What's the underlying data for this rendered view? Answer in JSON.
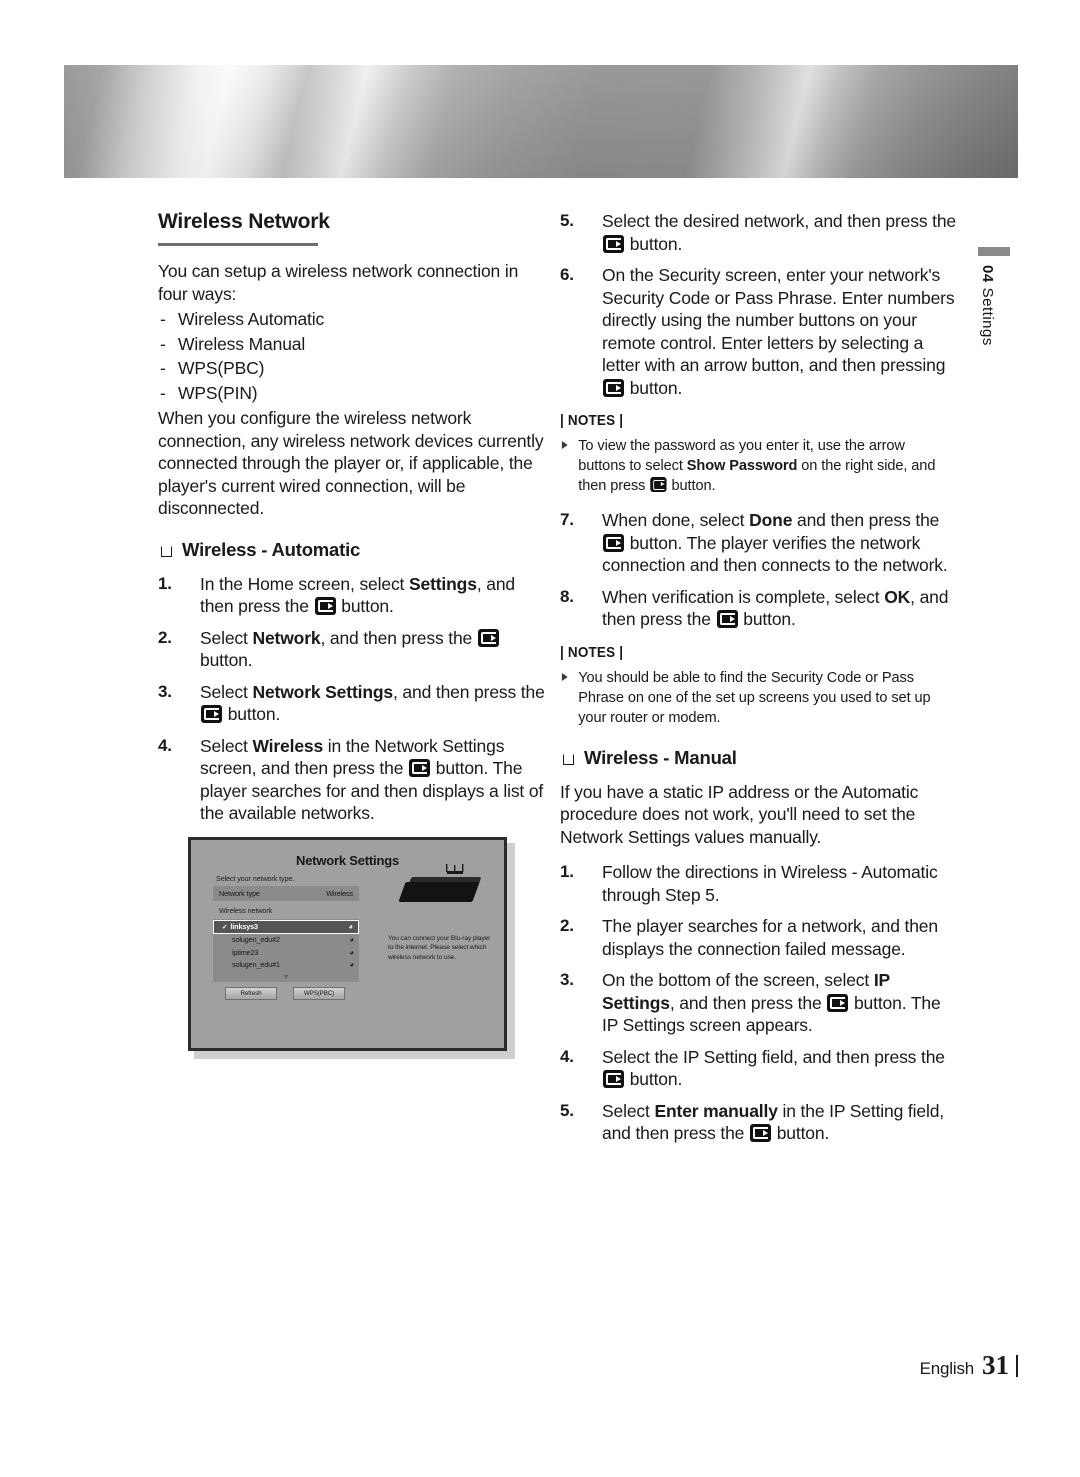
{
  "banner": {
    "name": "metallic-header-banner"
  },
  "left_column": {
    "section_title": "Wireless Network",
    "intro": "You can setup a wireless network connection in four ways:",
    "methods": [
      "Wireless Automatic",
      "Wireless Manual",
      "WPS(PBC)",
      "WPS(PIN)"
    ],
    "paragraph2": "When you configure the wireless network connection, any wireless network devices currently connected through the player or, if applicable, the player's current wired connection, will be disconnected.",
    "sub_head": "Wireless - Automatic",
    "steps": [
      {
        "num": "1.",
        "a": "In the Home screen, select ",
        "b": "Settings",
        "c": ", and then press the ",
        "d": " button."
      },
      {
        "num": "2.",
        "a": "Select ",
        "b": "Network",
        "c": ", and then press the ",
        "d": " button."
      },
      {
        "num": "3.",
        "a": "Select ",
        "b": "Network Settings",
        "c": ", and then press the ",
        "d": " button."
      },
      {
        "num": "4.",
        "a": "Select ",
        "b": "Wireless",
        "c": " in the Network Settings screen, and then press the ",
        "d": " button. The player searches for and then displays a list of the available networks."
      }
    ]
  },
  "screenshot": {
    "title": "Network Settings",
    "subtitle": "Select your network type.",
    "network_type_label": "Network type",
    "network_type_value": "Wireless",
    "wireless_network_label": "Wireless network",
    "networks": [
      {
        "name": "linksys3",
        "selected": true,
        "signal": "full"
      },
      {
        "name": "solugen_edu#2",
        "selected": false,
        "signal": "weak"
      },
      {
        "name": "iptime23",
        "selected": false,
        "signal": "weak"
      },
      {
        "name": "solugen_edu#1",
        "selected": false,
        "signal": "weak"
      }
    ],
    "buttons": [
      "Refresh",
      "WPS(PBC)"
    ],
    "description": "You can connect your Blu-ray player to the internet. Please select which wireless network to use."
  },
  "right_column": {
    "steps_top": [
      {
        "num": "5.",
        "a": "Select the desired network, and then press the ",
        "b": "",
        "c": "",
        "d": " button."
      },
      {
        "num": "6.",
        "a": "On the Security screen, enter your network's Security Code or Pass Phrase. Enter numbers directly using the number buttons on your remote control. Enter letters by selecting a letter with an arrow button, and then pressing ",
        "b": "",
        "c": "",
        "d": " button."
      }
    ],
    "notes_label_1": "| NOTES |",
    "note_1": {
      "a": "To view the password as you enter it, use the arrow buttons to select ",
      "b": "Show Password",
      "c": " on the right side, and then press ",
      "d": " button."
    },
    "steps_mid": [
      {
        "num": "7.",
        "a": "When done, select ",
        "b": "Done",
        "c": " and then press the ",
        "d": " button. The player verifies the network connection and then connects to the network."
      },
      {
        "num": "8.",
        "a": "When verification is complete, select ",
        "b": "OK",
        "c": ", and then press the ",
        "d": " button."
      }
    ],
    "notes_label_2": "| NOTES |",
    "note_2": {
      "a": "You should be able to find the Security Code or Pass Phrase on one of the set up screens you used to set up your router or modem.",
      "b": "",
      "c": "",
      "d": ""
    },
    "sub_head": "Wireless - Manual",
    "manual_intro": "If you have a static IP address or the Automatic procedure does not work, you'll need to set the Network Settings values manually.",
    "steps_bottom": [
      {
        "num": "1.",
        "a": "Follow the directions in Wireless - Automatic through Step 5.",
        "b": "",
        "c": "",
        "d": ""
      },
      {
        "num": "2.",
        "a": "The player searches for a network, and then displays the connection failed message.",
        "b": "",
        "c": "",
        "d": ""
      },
      {
        "num": "3.",
        "a": "On the bottom of the screen, select ",
        "b": "IP Settings",
        "c": ", and then press the ",
        "d": " button. The IP Settings screen appears."
      },
      {
        "num": "4.",
        "a": "Select the IP Setting field, and then press the ",
        "b": "",
        "c": "",
        "d": " button."
      },
      {
        "num": "5.",
        "a": "Select ",
        "b": "Enter manually",
        "c": " in the IP Setting field, and then press the ",
        "d": " button."
      }
    ]
  },
  "side_tab": {
    "number": "04",
    "label": "Settings"
  },
  "footer": {
    "language": "English",
    "page": "31"
  }
}
